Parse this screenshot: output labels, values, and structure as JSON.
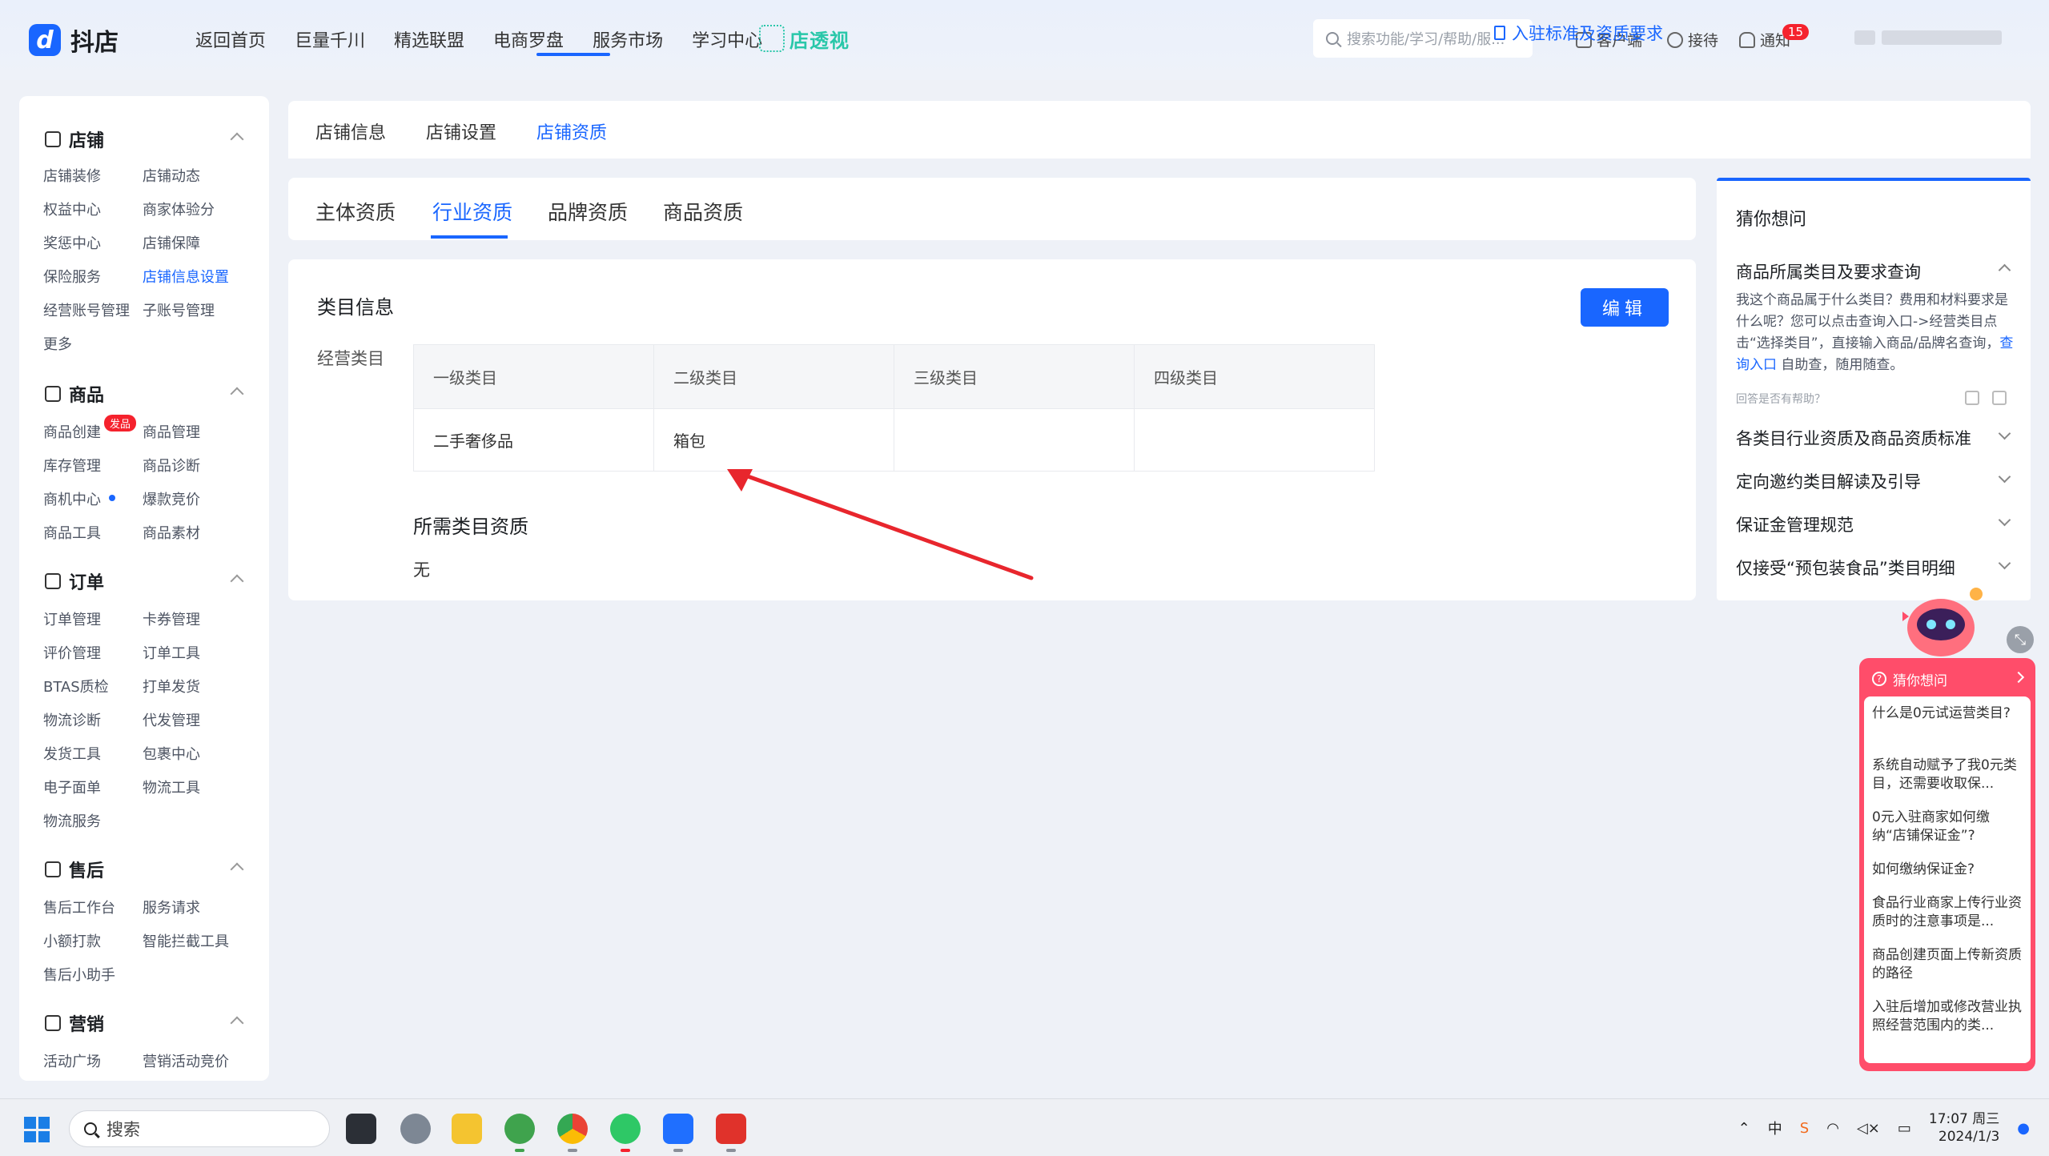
{
  "header": {
    "app_name": "抖店",
    "nav": [
      "返回首页",
      "巨量千川",
      "精选联盟",
      "电商罗盘",
      "服务市场",
      "学习中心"
    ],
    "brand_badge": "店透视",
    "search_placeholder": "搜索功能/学习/帮助/服...",
    "tools": {
      "client": "客户端",
      "reception": "接待",
      "notify": "通知",
      "notify_count": "15"
    }
  },
  "sidebar": {
    "sections": [
      {
        "title": "店铺",
        "icon": "store-icon",
        "items": [
          "店铺装修",
          "店铺动态",
          "权益中心",
          "商家体验分",
          "奖惩中心",
          "店铺保障",
          "保险服务",
          "店铺信息设置",
          "经营账号管理",
          "子账号管理",
          "更多"
        ],
        "active": "店铺信息设置"
      },
      {
        "title": "商品",
        "icon": "product-icon",
        "items": [
          "商品创建",
          "商品管理",
          "库存管理",
          "商品诊断",
          "商机中心",
          "爆款竞价",
          "商品工具",
          "商品素材"
        ],
        "badge": "发品"
      },
      {
        "title": "订单",
        "icon": "order-icon",
        "items": [
          "订单管理",
          "卡券管理",
          "评价管理",
          "订单工具",
          "BTAS质检",
          "打单发货",
          "物流诊断",
          "代发管理",
          "发货工具",
          "包裹中心",
          "电子面单",
          "物流工具",
          "物流服务"
        ]
      },
      {
        "title": "售后",
        "icon": "aftersale-icon",
        "items": [
          "售后工作台",
          "服务请求",
          "小额打款",
          "智能拦截工具",
          "售后小助手"
        ]
      },
      {
        "title": "营销",
        "icon": "marketing-icon",
        "items": [
          "活动广场",
          "营销活动竞价"
        ]
      }
    ]
  },
  "tabs": [
    "店铺信息",
    "店铺设置",
    "店铺资质"
  ],
  "active_tab": "店铺资质",
  "subtabs": [
    "主体资质",
    "行业资质",
    "品牌资质",
    "商品资质"
  ],
  "active_subtab": "行业资质",
  "req_link": "入驻标准及资质要求",
  "content": {
    "section_title": "类目信息",
    "edit_label": "编辑",
    "field_label": "经营类目",
    "table": {
      "headers": [
        "一级类目",
        "二级类目",
        "三级类目",
        "四级类目"
      ],
      "rows": [
        [
          "二手奢侈品",
          "箱包",
          "",
          ""
        ]
      ]
    },
    "required_title": "所需类目资质",
    "required_value": "无"
  },
  "faq": {
    "title": "猜你想问",
    "items": [
      "商品所属类目及要求查询",
      "各类目行业资质及商品资质标准",
      "定向邀约类目解读及引导",
      "保证金管理规范",
      "仅接受“预包装食品”类目明细"
    ],
    "answer_pre": "我这个商品属于什么类目？费用和材料要求是什么呢？您可以点击查询入口->经营类目点击“选择类目”，直接输入商品/品牌名查询，",
    "answer_link": "查询入口",
    "answer_post": " 自助查，随用随查。",
    "helpful": "回答是否有帮助？"
  },
  "assistant": {
    "title": "猜你想问",
    "items": [
      "什么是0元试运营类目?",
      "系统自动赋予了我0元类目，还需要收取保...",
      "0元入驻商家如何缴纳“店铺保证金”?",
      "如何缴纳保证金?",
      "食品行业商家上传行业资质时的注意事项是...",
      "商品创建页面上传新资质的路径",
      "入驻后增加或修改营业执照经营范围内的类..."
    ]
  },
  "taskbar": {
    "search": "搜索",
    "ime": "中",
    "time": "17:07 周三",
    "date": "2024/1/3"
  },
  "colors": {
    "accent": "#1966ff",
    "danger": "#f5222d",
    "assistant": "#ff4d6a",
    "arrow": "#e8262d"
  }
}
